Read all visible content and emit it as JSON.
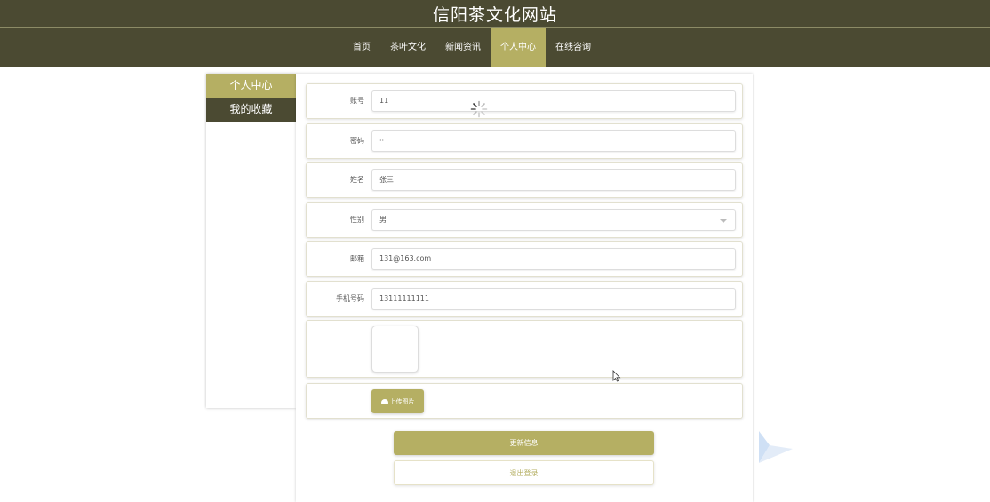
{
  "site": {
    "title": "信阳茶文化网站"
  },
  "nav": {
    "items": [
      {
        "label": "首页"
      },
      {
        "label": "茶叶文化"
      },
      {
        "label": "新闻资讯"
      },
      {
        "label": "个人中心",
        "active": true
      },
      {
        "label": "在线咨询"
      }
    ]
  },
  "sidebar": {
    "items": [
      {
        "label": "个人中心"
      },
      {
        "label": "我的收藏"
      }
    ]
  },
  "form": {
    "account": {
      "label": "账号",
      "value": "11"
    },
    "password": {
      "label": "密码",
      "value": "··"
    },
    "name": {
      "label": "姓名",
      "value": "张三"
    },
    "gender": {
      "label": "性别",
      "value": "男"
    },
    "email": {
      "label": "邮箱",
      "value": "131@163.com"
    },
    "phone": {
      "label": "手机号码",
      "value": "13111111111"
    },
    "upload_label": "上传图片",
    "update_label": "更新信息",
    "logout_label": "退出登录"
  },
  "colors": {
    "header_bg": "#4b4a32",
    "accent": "#b5af63"
  }
}
